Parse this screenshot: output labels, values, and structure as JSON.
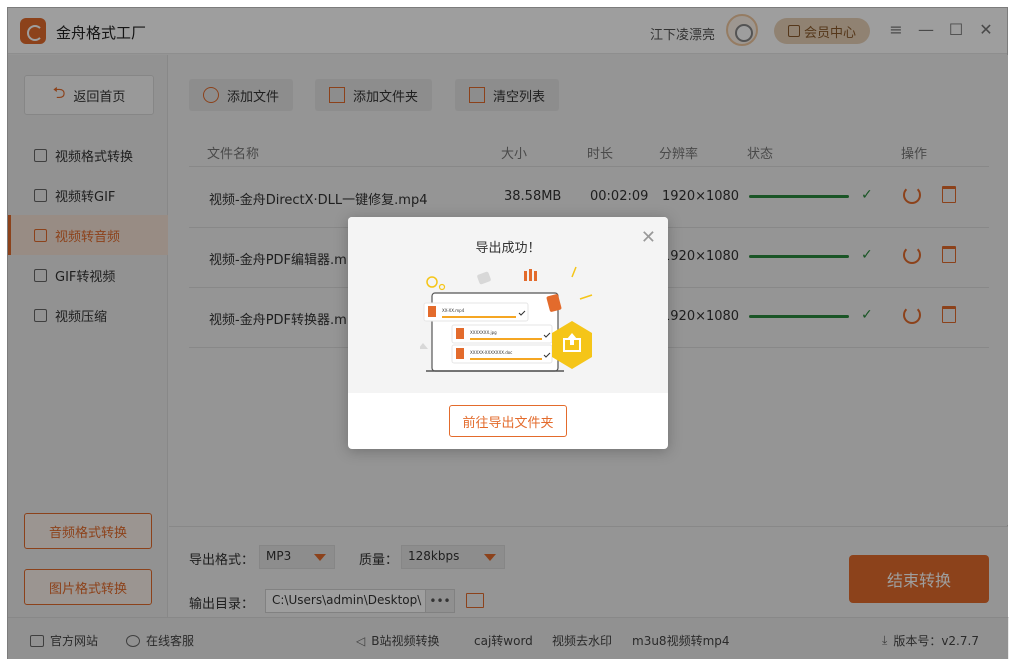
{
  "app": {
    "title": "金舟格式工厂",
    "username": "江下凌漂亮",
    "vip_label": "会员中心",
    "window_controls": [
      "menu-icon",
      "minimize-icon",
      "maximize-icon",
      "close-icon"
    ]
  },
  "sidebar": {
    "home_label": "返回首页",
    "items": [
      {
        "label": "视频格式转换",
        "icon": "video-icon",
        "active": false
      },
      {
        "label": "视频转GIF",
        "icon": "image-icon",
        "active": false
      },
      {
        "label": "视频转音频",
        "icon": "music-icon",
        "active": true
      },
      {
        "label": "GIF转视频",
        "icon": "video-icon",
        "active": false
      },
      {
        "label": "视频压缩",
        "icon": "compress-icon",
        "active": false
      }
    ],
    "bottom_buttons": [
      "音频格式转换",
      "图片格式转换"
    ]
  },
  "toolbar": {
    "add_file": "添加文件",
    "add_folder": "添加文件夹",
    "clear_list": "清空列表"
  },
  "table": {
    "headers": [
      "文件名称",
      "大小",
      "时长",
      "分辨率",
      "状态",
      "操作"
    ],
    "rows": [
      {
        "name": "视频-金舟DirectX·DLL一键修复.mp4",
        "size": "38.58MB",
        "duration": "00:02:09",
        "resolution": "1920×1080",
        "progress": 1.0
      },
      {
        "name": "视频-金舟PDF编辑器.mp4",
        "size": "",
        "duration": "",
        "resolution": "1920×1080",
        "progress": 1.0
      },
      {
        "name": "视频-金舟PDF转换器.mp4",
        "size": "",
        "duration": "",
        "resolution": "1920×1080",
        "progress": 1.0
      }
    ]
  },
  "settings": {
    "format_label": "导出格式：",
    "format_value": "MP3",
    "quality_label": "质量：",
    "quality_value": "128kbps",
    "output_label": "输出目录：",
    "output_path": "C:\\Users\\admin\\Desktop\\",
    "more_label": "•••",
    "convert_button": "结束转换"
  },
  "statusbar": {
    "website": "官方网站",
    "support": "在线客服",
    "links": [
      "B站视频转换",
      "caj转word",
      "视频去水印",
      "m3u8视频转mp4"
    ],
    "version": "版本号：v2.7.7"
  },
  "modal": {
    "title": "导出成功！",
    "open_folder_button": "前往导出文件夹",
    "illustration_files": [
      "XX-XX.mp4",
      "XXXXXXX.jpg",
      "XXXXX-XXXXXXX.doc"
    ]
  },
  "colors": {
    "accent": "#e36b2c",
    "success": "#2b8a3e",
    "illustration_yellow": "#f5c518"
  }
}
